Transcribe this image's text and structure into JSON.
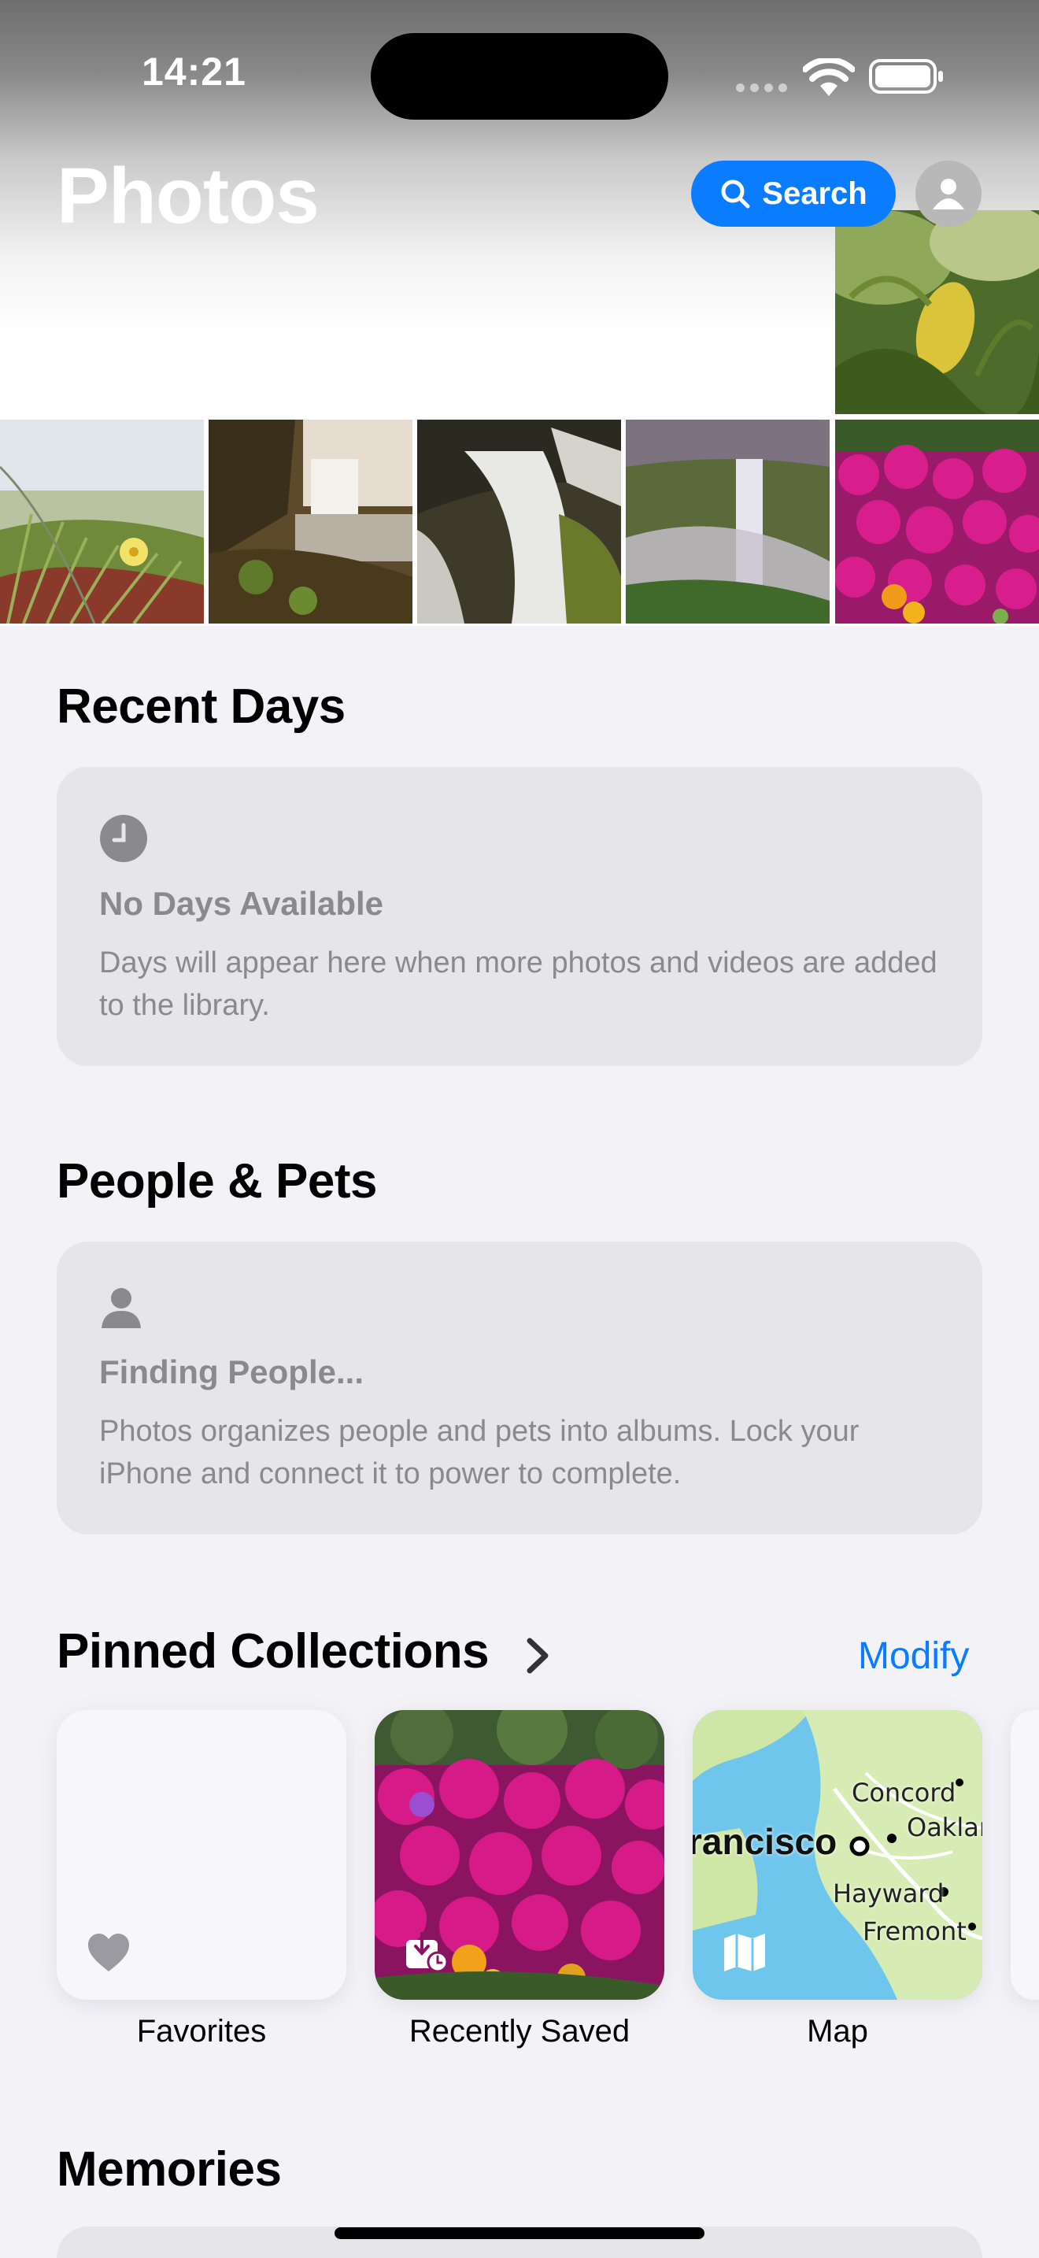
{
  "status_bar": {
    "time": "14:21"
  },
  "header": {
    "title": "Photos",
    "search_label": "Search"
  },
  "sections": {
    "recent_days": {
      "title": "Recent Days",
      "card_title": "No Days Available",
      "card_body": "Days will appear here when more photos and videos are added to the library."
    },
    "people_pets": {
      "title": "People & Pets",
      "card_title": "Finding People...",
      "card_body": "Photos organizes people and pets into albums. Lock your iPhone and connect it to power to complete."
    },
    "pinned": {
      "title": "Pinned Collections",
      "modify_label": "Modify",
      "tiles": [
        {
          "label": "Favorites",
          "icon": "heart-icon"
        },
        {
          "label": "Recently Saved",
          "icon": "recently-saved-icon"
        },
        {
          "label": "Map",
          "icon": "map-icon"
        }
      ],
      "map_labels": [
        "Concord",
        "Oaklan",
        "rancisco",
        "Hayward",
        "Fremont"
      ]
    },
    "memories": {
      "title": "Memories"
    }
  },
  "colors": {
    "accent": "#0a7cff",
    "background": "#f2f2f7",
    "card": "#e5e5ea",
    "secondary_text": "#8a8a8e"
  }
}
